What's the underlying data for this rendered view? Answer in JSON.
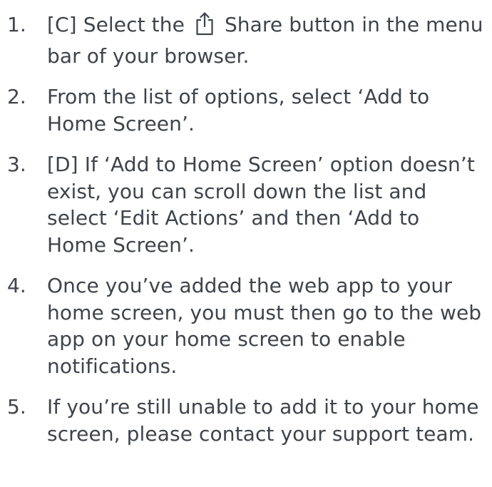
{
  "steps": [
    {
      "number": "1.",
      "before_icon": "[C] Select the",
      "icon": "share-icon",
      "after_icon": "Share button in the menu bar of your browser."
    },
    {
      "number": "2.",
      "text": "From the list of options, select ‘Add to Home Screen’."
    },
    {
      "number": "3.",
      "text": "[D] If ‘Add to Home Screen’ option doesn’t exist, you can scroll down the list and select ‘Edit Actions’ and then ‘Add to Home Screen’."
    },
    {
      "number": "4.",
      "text": "Once you’ve added the web app to your home screen, you must then go to the web app on your home screen to enable notifications."
    },
    {
      "number": "5.",
      "text": "If you’re still unable to add it to your home screen, please contact your support team."
    }
  ],
  "colors": {
    "text": "#3f434b",
    "background": "#ffffff"
  }
}
